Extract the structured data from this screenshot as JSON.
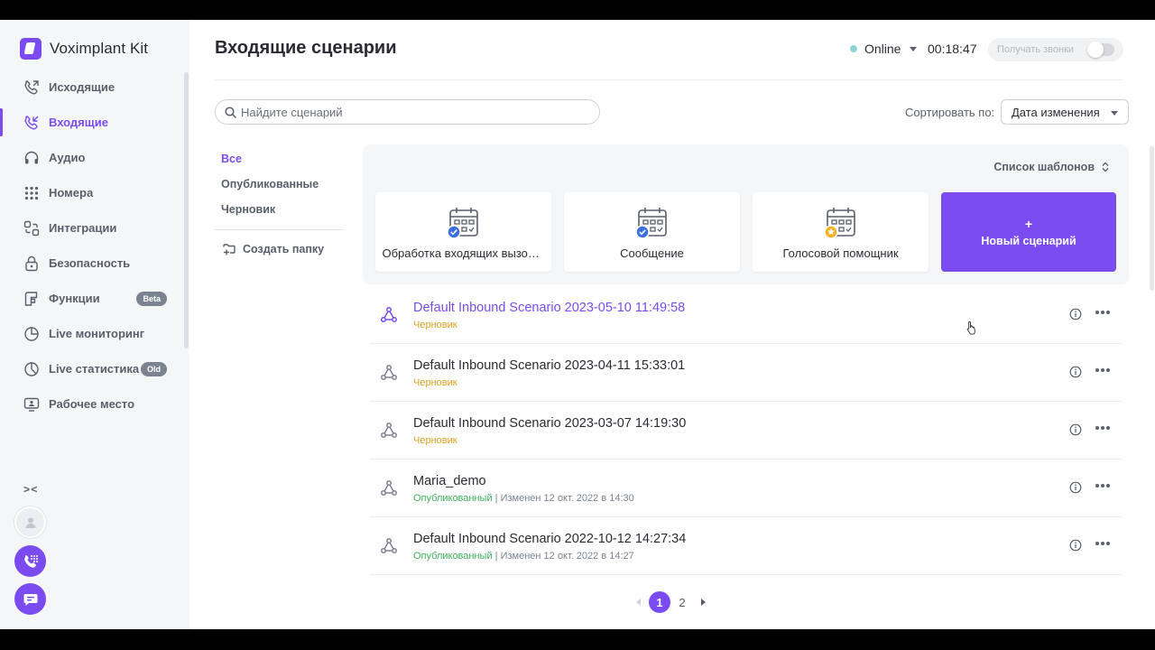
{
  "brand": {
    "name": "Voximplant Kit"
  },
  "sidebar": {
    "items": [
      {
        "label": "Исходящие",
        "icon": "outgoing-call-icon",
        "active": false,
        "badge": ""
      },
      {
        "label": "Входящие",
        "icon": "incoming-call-icon",
        "active": true,
        "badge": ""
      },
      {
        "label": "Аудио",
        "icon": "headphones-icon",
        "active": false,
        "badge": ""
      },
      {
        "label": "Номера",
        "icon": "dialpad-icon",
        "active": false,
        "badge": ""
      },
      {
        "label": "Интеграции",
        "icon": "integrations-icon",
        "active": false,
        "badge": ""
      },
      {
        "label": "Безопасность",
        "icon": "lock-icon",
        "active": false,
        "badge": ""
      },
      {
        "label": "Функции",
        "icon": "functions-icon",
        "active": false,
        "badge": "Beta"
      },
      {
        "label": "Live мониторинг",
        "icon": "monitoring-icon",
        "active": false,
        "badge": ""
      },
      {
        "label": "Live статистика",
        "icon": "statistics-icon",
        "active": false,
        "badge": "Old"
      },
      {
        "label": "Рабочее место",
        "icon": "workplace-icon",
        "active": false,
        "badge": ""
      }
    ],
    "collapse_label": "> <"
  },
  "header": {
    "title": "Входящие сценарии",
    "status": "Online",
    "timer": "00:18:47",
    "calls_toggle_label": "Получать звонки"
  },
  "search": {
    "placeholder": "Найдите сценарий",
    "value": ""
  },
  "sort": {
    "label": "Сортировать по:",
    "value": "Дата изменения"
  },
  "filters": {
    "items": [
      {
        "label": "Все",
        "active": true
      },
      {
        "label": "Опубликованные",
        "active": false
      },
      {
        "label": "Черновик",
        "active": false
      }
    ],
    "create_folder": "Создать папку"
  },
  "templates": {
    "toggle_label": "Список шаблонов",
    "cards": [
      {
        "name": "Обработка входящих вызовов",
        "badge": "check"
      },
      {
        "name": "Сообщение",
        "badge": "check"
      },
      {
        "name": "Голосовой помощник",
        "badge": "star"
      }
    ],
    "new_scenario": {
      "plus": "+",
      "label": "Новый сценарий"
    }
  },
  "scenarios": [
    {
      "title": "Default Inbound Scenario 2023-05-10 11:49:58",
      "status": "Черновик",
      "status_type": "draft",
      "modified": ""
    },
    {
      "title": "Default Inbound Scenario 2023-04-11 15:33:01",
      "status": "Черновик",
      "status_type": "draft",
      "modified": ""
    },
    {
      "title": "Default Inbound Scenario 2023-03-07 14:19:30",
      "status": "Черновик",
      "status_type": "draft",
      "modified": ""
    },
    {
      "title": "Maria_demo",
      "status": "Опубликованный",
      "status_type": "published",
      "modified": " | Изменен 12 окт. 2022 в 14:30"
    },
    {
      "title": "Default Inbound Scenario 2022-10-12 14:27:34",
      "status": "Опубликованный",
      "status_type": "published",
      "modified": " | Изменен 12 окт. 2022 в 14:27"
    }
  ],
  "pagination": {
    "pages": [
      "1",
      "2"
    ],
    "current": "1"
  },
  "colors": {
    "accent": "#7a4cf0",
    "draft": "#e0a020",
    "published": "#3fb25c",
    "online": "#8fd3d8",
    "check_badge": "#3b6fe0",
    "star_badge": "#f5b323"
  }
}
